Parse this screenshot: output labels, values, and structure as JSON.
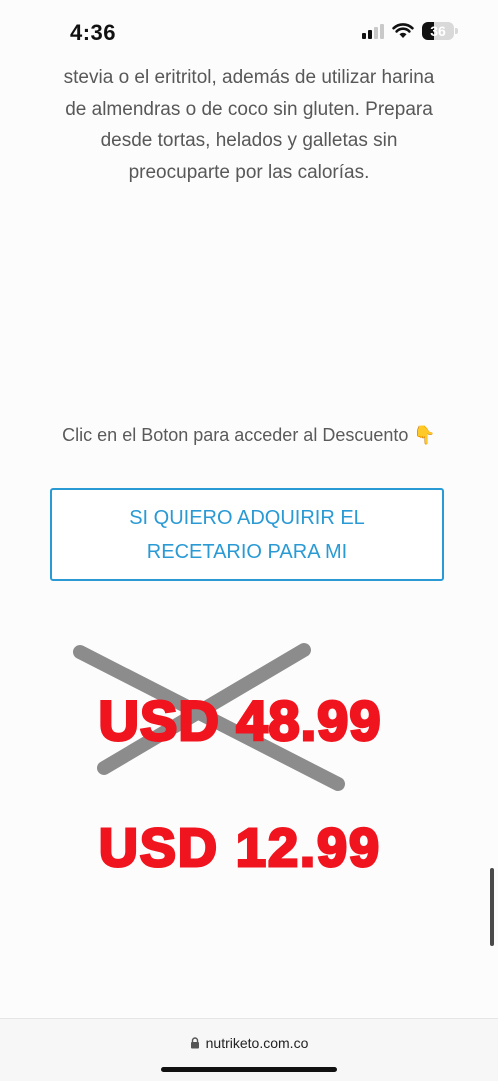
{
  "status_bar": {
    "time": "4:36",
    "battery_percent": "36",
    "signal_bars_active": 2,
    "signal_bars_total": 4
  },
  "content": {
    "intro_lines": [
      "stevia o el eritritol, además de utilizar harina",
      "de almendras o de coco sin gluten. Prepara",
      "desde tortas, helados y galletas sin",
      "preocuparte por las calorías."
    ],
    "clic_text": "Clic en el Boton para acceder al Descuento",
    "clic_emoji": "👇",
    "cta_label": "SI QUIERO ADQUIRIR EL RECETARIO PARA MI",
    "old_price": "USD 48.99",
    "new_price": "USD 12.99"
  },
  "browser": {
    "url": "nutriketo.com.co"
  },
  "colors": {
    "accent": "#2a9ad4",
    "price_red": "#f0141e",
    "strike_gray": "#8c8c8c"
  }
}
